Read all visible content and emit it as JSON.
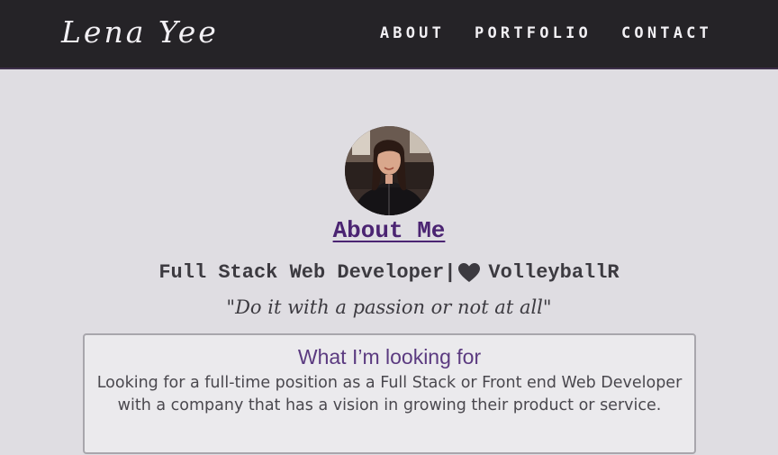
{
  "navbar": {
    "brand": "Lena Yee",
    "links": [
      "ABOUT",
      "PORTFOLIO",
      "CONTACT"
    ]
  },
  "profile": {
    "avatar_alt": "Profile photo"
  },
  "about": {
    "heading": "About Me",
    "tagline_left": "Full Stack Web Developer|",
    "tagline_icon": "heart-icon",
    "tagline_right": "VolleyballR",
    "quote": "\"Do it with a passion or not at all\""
  },
  "card": {
    "title": "What I’m looking for",
    "body": "Looking for a full-time position as a Full Stack or Front end Web Developer with a company that has a vision in growing their product or service."
  },
  "colors": {
    "navbar_bg": "#252327",
    "page_bg": "#dfdde2",
    "accent": "#4b2472",
    "card_title": "#5b3a80"
  }
}
